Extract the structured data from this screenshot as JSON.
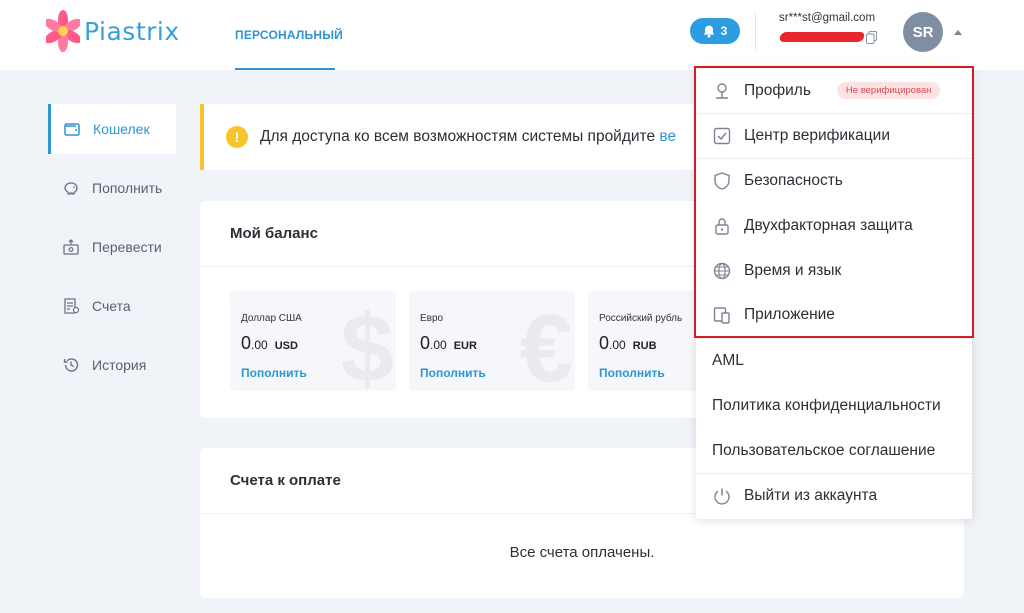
{
  "header": {
    "brand": "Piastrix",
    "tab_personal": "ПЕРСОНАЛЬНЫЙ",
    "notifications_count": "3",
    "email": "sr***st@gmail.com",
    "avatar_initials": "SR"
  },
  "sidebar": {
    "items": [
      {
        "label": "Кошелек"
      },
      {
        "label": "Пополнить"
      },
      {
        "label": "Перевести"
      },
      {
        "label": "Счета"
      },
      {
        "label": "История"
      }
    ]
  },
  "alert": {
    "text": "Для доступа ко всем возможностям системы пройдите ",
    "link": "ве"
  },
  "balance": {
    "title": "Мой баланс",
    "currencies": [
      {
        "name": "Доллар США",
        "int": "0",
        "frac": ".00",
        "code": "USD",
        "action": "Пополнить",
        "symbol": "$"
      },
      {
        "name": "Евро",
        "int": "0",
        "frac": ".00",
        "code": "EUR",
        "action": "Пополнить",
        "symbol": "€"
      },
      {
        "name": "Российский рубль",
        "int": "0",
        "frac": ".00",
        "code": "RUB",
        "action": "Пополнить",
        "symbol": "₽"
      }
    ]
  },
  "invoices": {
    "title": "Счета к оплате",
    "empty_text": "Все счета оплачены."
  },
  "dropdown": {
    "profile": "Профиль",
    "profile_badge": "Не верифицирован",
    "verification": "Центр верификации",
    "security": "Безопасность",
    "twofa": "Двухфакторная защита",
    "time_lang": "Время и язык",
    "app": "Приложение",
    "aml": "AML",
    "privacy": "Политика конфиденциальности",
    "agreement": "Пользовательское соглашение",
    "logout": "Выйти из аккаунта"
  },
  "colors": {
    "accent": "#2f95d2",
    "warning": "#f6c42b",
    "highlight_border": "#d21d24",
    "badge_text": "#e0484c"
  }
}
